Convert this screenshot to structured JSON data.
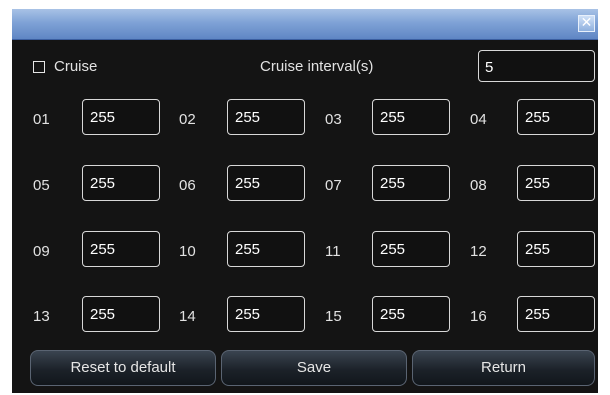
{
  "dialog": {
    "close_glyph": "✕"
  },
  "cruise": {
    "checkbox_label": "Cruise",
    "checked": false,
    "interval_label": "Cruise interval(s)",
    "interval_value": "5"
  },
  "presets": [
    {
      "label": "01",
      "value": "255"
    },
    {
      "label": "02",
      "value": "255"
    },
    {
      "label": "03",
      "value": "255"
    },
    {
      "label": "04",
      "value": "255"
    },
    {
      "label": "05",
      "value": "255"
    },
    {
      "label": "06",
      "value": "255"
    },
    {
      "label": "07",
      "value": "255"
    },
    {
      "label": "08",
      "value": "255"
    },
    {
      "label": "09",
      "value": "255"
    },
    {
      "label": "10",
      "value": "255"
    },
    {
      "label": "11",
      "value": "255"
    },
    {
      "label": "12",
      "value": "255"
    },
    {
      "label": "13",
      "value": "255"
    },
    {
      "label": "14",
      "value": "255"
    },
    {
      "label": "15",
      "value": "255"
    },
    {
      "label": "16",
      "value": "255"
    }
  ],
  "buttons": {
    "reset": "Reset to default",
    "save": "Save",
    "return": "Return"
  }
}
